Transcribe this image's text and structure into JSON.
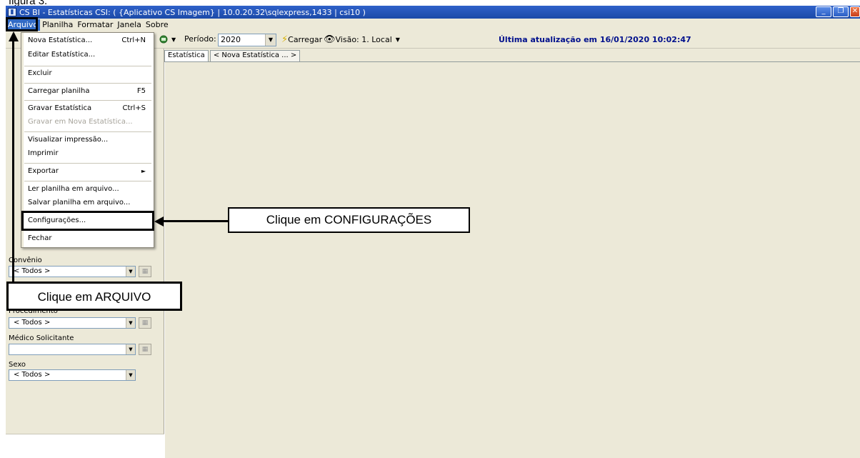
{
  "caption": "figura 3.",
  "window": {
    "title": "CS BI - Estatísticas CSI: ( {Aplicativo CS Imagem} | 10.0.20.32\\sqlexpress,1433 | csi10 )",
    "buttons": [
      "_",
      "❐",
      "✕"
    ]
  },
  "menubar": [
    "Arquivo",
    "Planilha",
    "Formatar",
    "Janela",
    "Sobre"
  ],
  "toolbar": {
    "periodo_label": "Período:",
    "periodo_value": "2020",
    "carregar_label": "Carregar",
    "visao_label": "Visão: 1. Local",
    "update_text": "Última atualização em 16/01/2020 10:02:47"
  },
  "tabs": [
    "Estatística",
    "< Nova Estatística ... >"
  ],
  "arquivo_menu": [
    {
      "label": "Nova Estatística...",
      "shortcut": "Ctrl+N"
    },
    {
      "label": "Editar Estatística...",
      "shortcut": ""
    },
    {
      "label": "Excluir",
      "shortcut": ""
    },
    {
      "label": "Carregar planilha",
      "shortcut": "F5"
    },
    {
      "label": "Gravar Estatística",
      "shortcut": "Ctrl+S"
    },
    {
      "label": "Gravar em Nova Estatística...",
      "shortcut": ""
    },
    {
      "label": "Visualizar impressão...",
      "shortcut": ""
    },
    {
      "label": "Imprimir",
      "shortcut": ""
    },
    {
      "label": "Exportar",
      "shortcut": "►"
    },
    {
      "label": "Ler planilha em arquivo...",
      "shortcut": ""
    },
    {
      "label": "Salvar planilha em arquivo...",
      "shortcut": ""
    },
    {
      "label": "Configurações...",
      "shortcut": ""
    },
    {
      "label": "Fechar",
      "shortcut": ""
    }
  ],
  "filters": [
    {
      "label": "Convênio",
      "value": "< Todos >"
    },
    {
      "label": "Procedimento",
      "value": "< Todos >"
    },
    {
      "label": "Médico Solicitante",
      "value": ""
    },
    {
      "label": "Sexo",
      "value": "< Todos >"
    }
  ],
  "callouts": {
    "configuracoes": "Clique em CONFIGURAÇÕES",
    "arquivo": "Clique em ARQUIVO"
  }
}
